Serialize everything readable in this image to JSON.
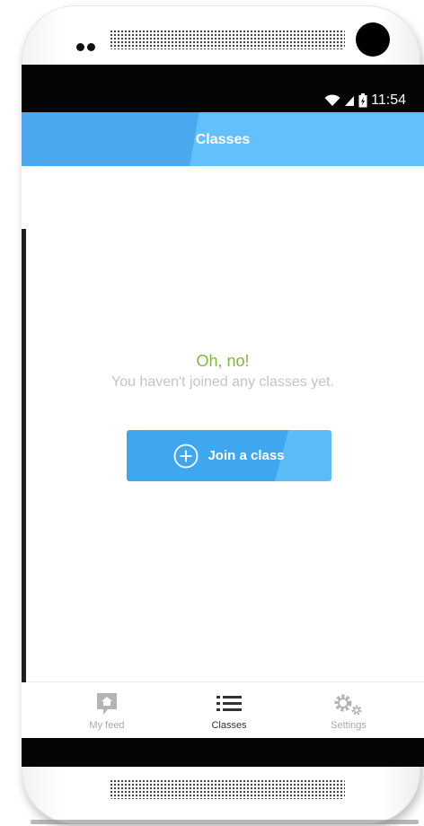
{
  "status_bar": {
    "time": "11:54",
    "icons": [
      "wifi-icon",
      "signal-icon",
      "battery-icon"
    ]
  },
  "app_bar": {
    "title": "Classes"
  },
  "empty_state": {
    "title": "Oh, no!",
    "message": "You haven't joined any classes yet.",
    "button_label": "Join a class",
    "button_icon": "plus-circle-icon"
  },
  "tabs": [
    {
      "label": "My feed",
      "icon": "home-chat-icon",
      "active": false
    },
    {
      "label": "Classes",
      "icon": "list-icon",
      "active": true
    },
    {
      "label": "Settings",
      "icon": "gears-icon",
      "active": false
    }
  ],
  "colors": {
    "accent": "#4aa8ee",
    "accent_light": "#62c0fb",
    "empty_title": "#7ab93c",
    "muted_text": "#c4c4c4"
  }
}
